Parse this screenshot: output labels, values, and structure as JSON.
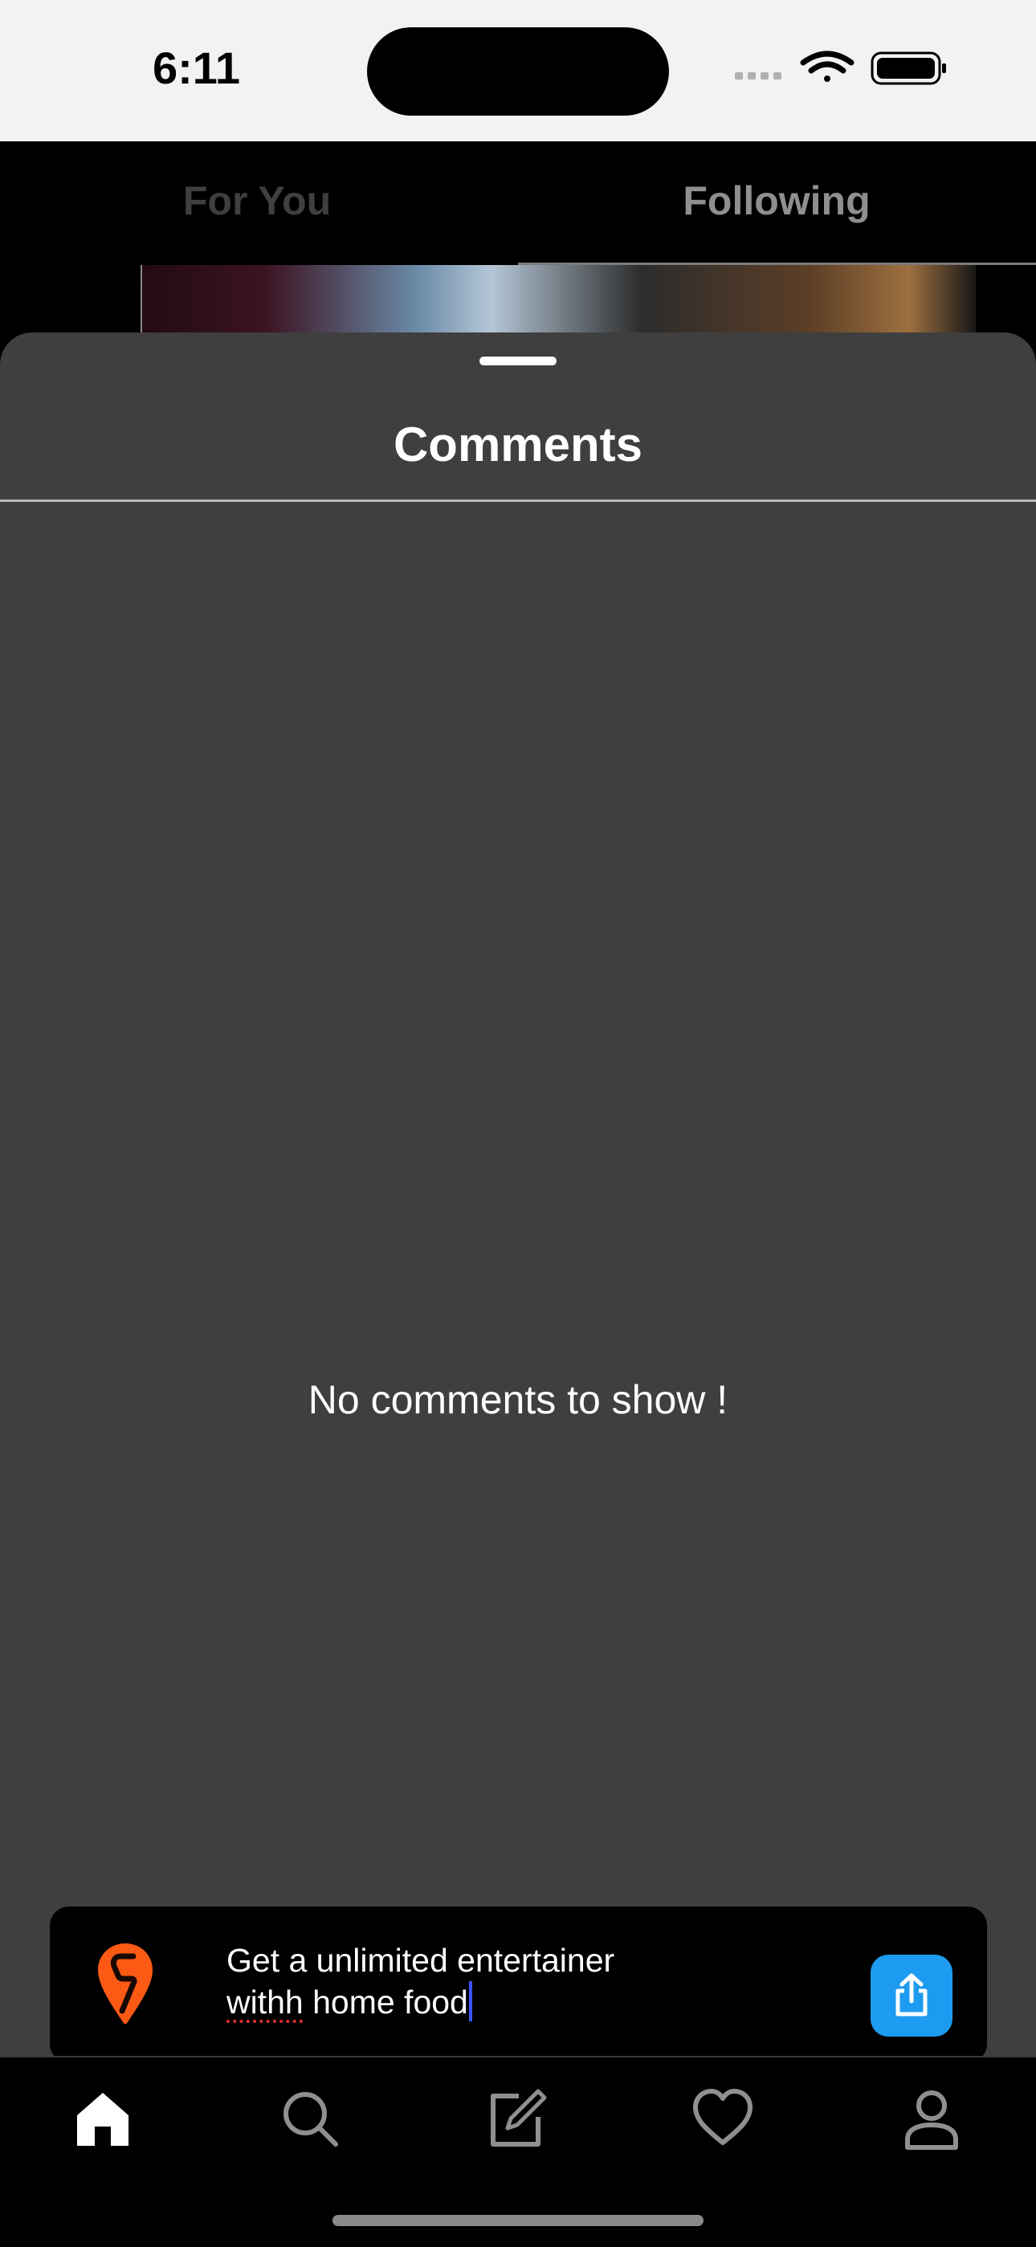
{
  "status_bar": {
    "time": "6:11",
    "icons": [
      "cellular-signal-icon",
      "wifi-icon",
      "battery-icon"
    ]
  },
  "top_tabs": {
    "for_you": "For You",
    "following": "Following",
    "selected": "Following"
  },
  "comments_sheet": {
    "title": "Comments",
    "empty_message": "No comments to show !"
  },
  "composer": {
    "brand_icon": "swiggy-logo-icon",
    "brand_color": "#fc5a14",
    "text_line1": "Get a unlimited entertainer",
    "text_line2_misspelled": "withh",
    "text_line2_rest": " home food",
    "send_icon": "share-upload-icon",
    "send_color": "#1d9bf0"
  },
  "tab_bar": {
    "items": [
      "home-icon",
      "search-icon",
      "compose-icon",
      "heart-icon",
      "profile-icon"
    ],
    "active": "home-icon"
  }
}
